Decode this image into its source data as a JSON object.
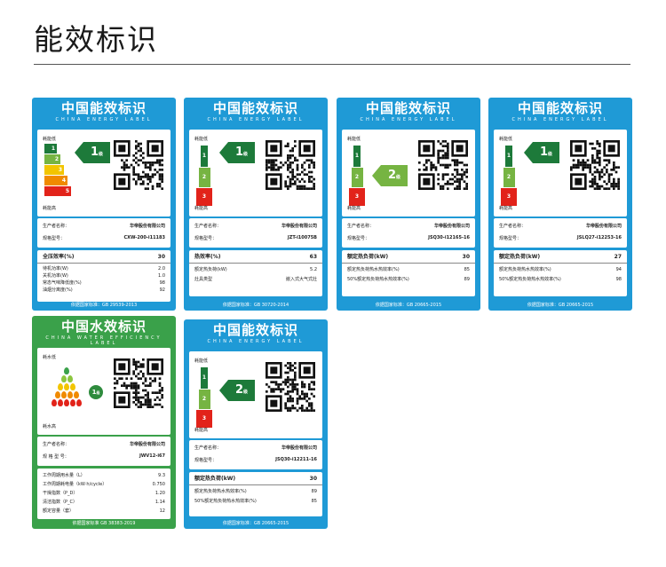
{
  "page": {
    "title": "能效标识"
  },
  "labels": [
    {
      "id": "l1",
      "header_cn": "中国能效标识",
      "header_en": "CHINA ENERGY LABEL",
      "rank_low": "耗能低",
      "rank_high": "耗能高",
      "scale": [
        "1",
        "2",
        "3",
        "4",
        "5"
      ],
      "grade": "1",
      "grade_unit": "级",
      "producer_label": "生产者名称：",
      "producer": "华帝股份有限公司",
      "model_label": "规格型号：",
      "model": "CXW-200-i11183",
      "data": [
        {
          "k": "全压效率(%)",
          "v": "30"
        },
        {
          "k": "待机功率(W)",
          "v": "2.0"
        },
        {
          "k": "关机功率(W)",
          "v": "1.0"
        },
        {
          "k": "常态气味降低度(%)",
          "v": "98"
        },
        {
          "k": "油烟分离度(%)",
          "v": "92"
        }
      ],
      "footer": "依据国家标准：GB 29539-2013"
    },
    {
      "id": "l2",
      "header_cn": "中国能效标识",
      "header_en": "CHINA ENERGY LABEL",
      "rank_low": "耗能低",
      "rank_high": "耗能高",
      "scale": [
        "1",
        "2",
        "3"
      ],
      "grade": "1",
      "grade_unit": "级",
      "producer_label": "生产者名称：",
      "producer": "华帝股份有限公司",
      "model_label": "规格型号：",
      "model": "JZT-i10075B",
      "data": [
        {
          "k": "热效率(%)",
          "v": "63"
        },
        {
          "k": "额定热负荷(kW)",
          "v": "5.2"
        },
        {
          "k": "灶具类型",
          "v": "嵌入式大气式灶"
        }
      ],
      "footer": "依据国家标准：GB 30720-2014"
    },
    {
      "id": "l3",
      "header_cn": "中国能效标识",
      "header_en": "CHINA ENERGY LABEL",
      "rank_low": "耗能低",
      "rank_high": "耗能高",
      "scale": [
        "1",
        "2",
        "3"
      ],
      "grade": "2",
      "grade_unit": "级",
      "producer_label": "生产者名称：",
      "producer": "华帝股份有限公司",
      "model_label": "规格型号：",
      "model": "JSQ30-i12165-16",
      "data": [
        {
          "k": "额定热负荷(kW)",
          "v": "30"
        },
        {
          "k": "额定热负荷热水热效率(%)",
          "v": "85"
        },
        {
          "k": "50%额定热负荷热水热效率(%)",
          "v": "89"
        }
      ],
      "footer": "依据国家标准：GB 20665-2015"
    },
    {
      "id": "l4",
      "header_cn": "中国能效标识",
      "header_en": "CHINA ENERGY LABEL",
      "rank_low": "耗能低",
      "rank_high": "耗能高",
      "scale": [
        "1",
        "2",
        "3"
      ],
      "grade": "1",
      "grade_unit": "级",
      "producer_label": "生产者名称：",
      "producer": "华帝股份有限公司",
      "model_label": "规格型号：",
      "model": "JSLQ27-i12253-16",
      "data": [
        {
          "k": "额定热负荷(kW)",
          "v": "27"
        },
        {
          "k": "额定热负荷热水热效率(%)",
          "v": "94"
        },
        {
          "k": "50%额定热负荷热水热效率(%)",
          "v": "98"
        }
      ],
      "footer": "依据国家标准：GB 20665-2015"
    },
    {
      "id": "l5",
      "header_cn": "中国水效标识",
      "header_en": "CHINA WATER EFFICIENCY LABEL",
      "rank_low": "耗水低",
      "rank_high": "耗水高",
      "grade": "1",
      "grade_unit": "级",
      "producer_label": "生产者名称：",
      "producer": "华帝股份有限公司",
      "model_label": "规 格 型 号：",
      "model": "JWV12-i67",
      "data": [
        {
          "k": "工作周期用水量（L）",
          "v": "9.3"
        },
        {
          "k": "工作周期耗电量（kW·h/cycle）",
          "v": "0.750"
        },
        {
          "k": "干燥指数（P_D）",
          "v": "1.20"
        },
        {
          "k": "清洁指数（P_C）",
          "v": "1.14"
        },
        {
          "k": "额定容量（套）",
          "v": "12"
        }
      ],
      "footer": "依据国家标准 GB 38383-2019"
    },
    {
      "id": "l6",
      "header_cn": "中国能效标识",
      "header_en": "CHINA ENERGY LABEL",
      "rank_low": "耗能低",
      "rank_high": "耗能高",
      "scale": [
        "1",
        "2",
        "3"
      ],
      "grade": "2",
      "grade_unit": "级",
      "producer_label": "生产者名称：",
      "producer": "华帝股份有限公司",
      "model_label": "规格型号：",
      "model": "JSQ30-i12211-16",
      "data": [
        {
          "k": "额定热负荷(kW)",
          "v": "30"
        },
        {
          "k": "额定热负荷热水热效率(%)",
          "v": "89"
        },
        {
          "k": "50%额定热负荷热水热效率(%)",
          "v": "85"
        }
      ],
      "footer": "依据国家标准：GB 20665-2015"
    }
  ],
  "colors": {
    "label_blue": "#1f9ad6",
    "label_green": "#3aa14a",
    "grade_dark_green": "#1d7a3a",
    "grade_light_green": "#76b442",
    "scale": [
      "#1d7a3a",
      "#76b442",
      "#f2c500",
      "#f08a00",
      "#e2231a"
    ]
  },
  "icons": {
    "qr": "qr-code-icon",
    "grade_arrow": "grade-arrow-icon",
    "water_drop": "water-drop-icon"
  }
}
